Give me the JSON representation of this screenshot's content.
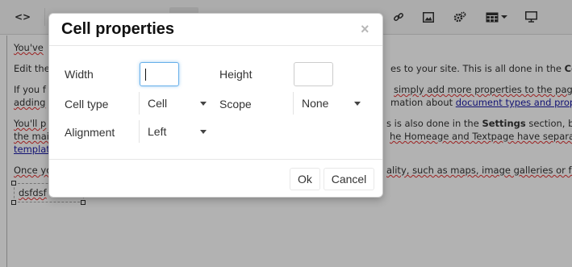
{
  "editor": {
    "toolbar": {
      "source_icon": "<>",
      "link_icon": "link-icon",
      "image_icon": "image-icon",
      "macro_icon": "gears-icon",
      "table_icon": "table-icon",
      "preview_icon": "monitor-icon"
    },
    "content": {
      "line1": "You've",
      "line2_start": "Edit the",
      "line2_end_prefix": "es to your site. This is all done in the ",
      "line2_end_bold": "Co",
      "line3_start": "If you f",
      "line3_end": "simply add more properties to the page",
      "line4_start": "adding",
      "line4_end_prefix": "mation about ",
      "line4_link": "document types and proper",
      "line5_start": "You'll p",
      "line5_end_prefix": "s is also done in the ",
      "line5_end_bold": "Settings",
      "line5_end_suffix": " section, by",
      "line6_start": "the mai",
      "line6_end": "he Homeage and Textpage have separat",
      "line7_start": "templat",
      "line8_start": "Once yo",
      "line8_end": "ality, such as maps, image galleries or fo",
      "cell_text": "dsfdsf"
    }
  },
  "dialog": {
    "title": "Cell properties",
    "close_symbol": "×",
    "width_label": "Width",
    "width_value": "",
    "height_label": "Height",
    "height_value": "",
    "cell_type_label": "Cell type",
    "cell_type_value": "Cell",
    "scope_label": "Scope",
    "scope_value": "None",
    "alignment_label": "Alignment",
    "alignment_value": "Left",
    "ok_label": "Ok",
    "cancel_label": "Cancel"
  }
}
